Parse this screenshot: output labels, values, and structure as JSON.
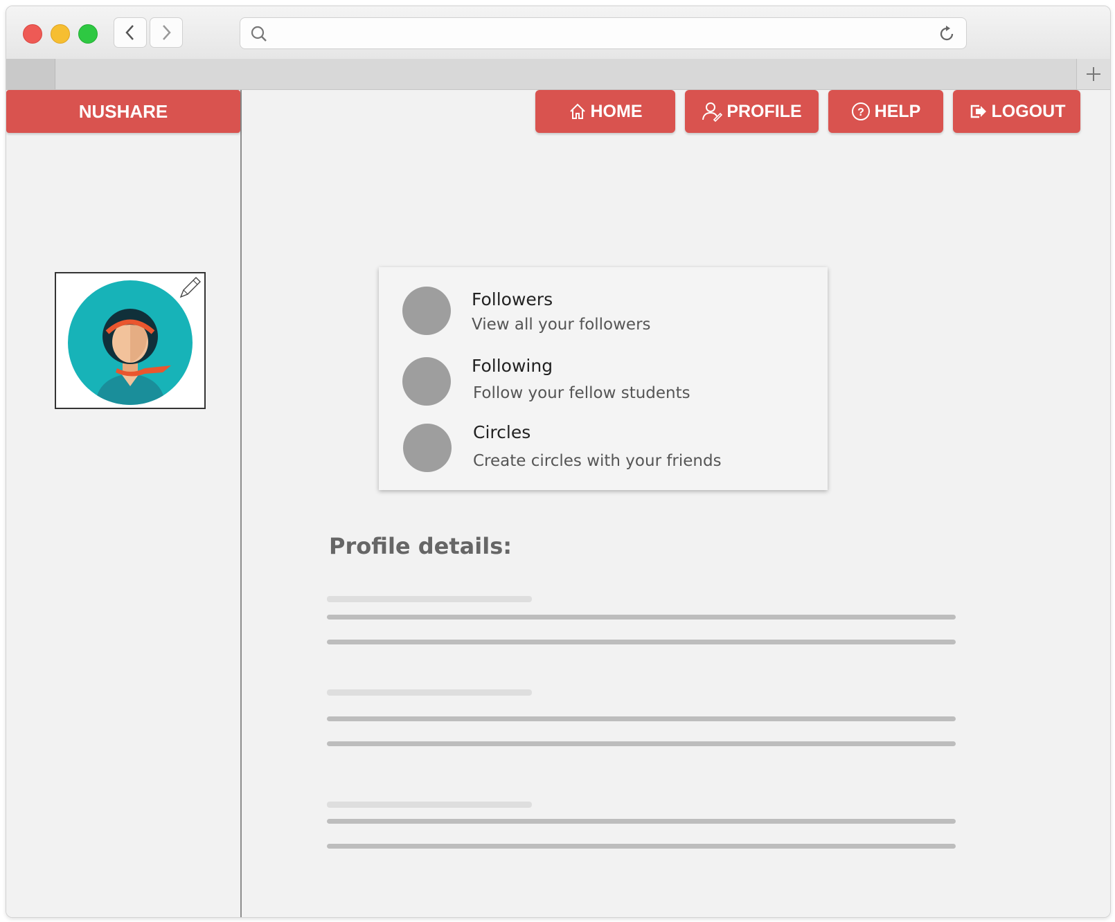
{
  "browser": {
    "url": ""
  },
  "brand": "NUSHARE",
  "nav": {
    "home": "HOME",
    "profile": "PROFILE",
    "help": "HELP",
    "logout": "LOGOUT"
  },
  "card": {
    "items": [
      {
        "title": "Followers",
        "subtitle": "View all your followers"
      },
      {
        "title": "Following",
        "subtitle": "Follow your fellow students"
      },
      {
        "title": "Circles",
        "subtitle": "Create circles with your friends"
      }
    ]
  },
  "profile_details": {
    "heading": "Profile details:"
  },
  "colors": {
    "accent": "#d9534f",
    "avatar_bg": "#17b3b8",
    "placeholder_circle": "#9e9e9e"
  },
  "icons": [
    "search-icon",
    "reload-icon",
    "back-icon",
    "forward-icon",
    "plus-icon",
    "home-icon",
    "user-icon",
    "help-icon",
    "logout-icon",
    "pencil-icon"
  ]
}
